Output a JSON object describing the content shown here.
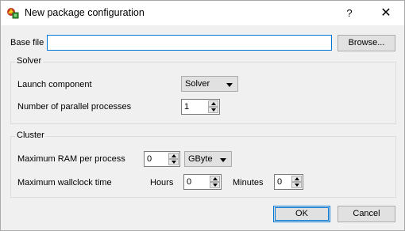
{
  "window": {
    "title": "New package configuration",
    "help_glyph": "?",
    "close_glyph": "✕"
  },
  "base_file": {
    "label": "Base file",
    "value": "",
    "browse_label": "Browse..."
  },
  "solver": {
    "group_title": "Solver",
    "launch_component": {
      "label": "Launch component",
      "value": "Solver"
    },
    "parallel_processes": {
      "label": "Number of parallel processes",
      "value": "1"
    }
  },
  "cluster": {
    "group_title": "Cluster",
    "max_ram": {
      "label": "Maximum RAM per process",
      "value": "0",
      "unit": "GByte"
    },
    "max_wallclock": {
      "label": "Maximum wallclock time",
      "hours_label": "Hours",
      "hours_value": "0",
      "minutes_label": "Minutes",
      "minutes_value": "0"
    }
  },
  "buttons": {
    "ok": "OK",
    "cancel": "Cancel"
  },
  "colors": {
    "accent": "#0078d7",
    "background": "#f0f0f0"
  },
  "icons": {
    "app": "package-icon"
  }
}
